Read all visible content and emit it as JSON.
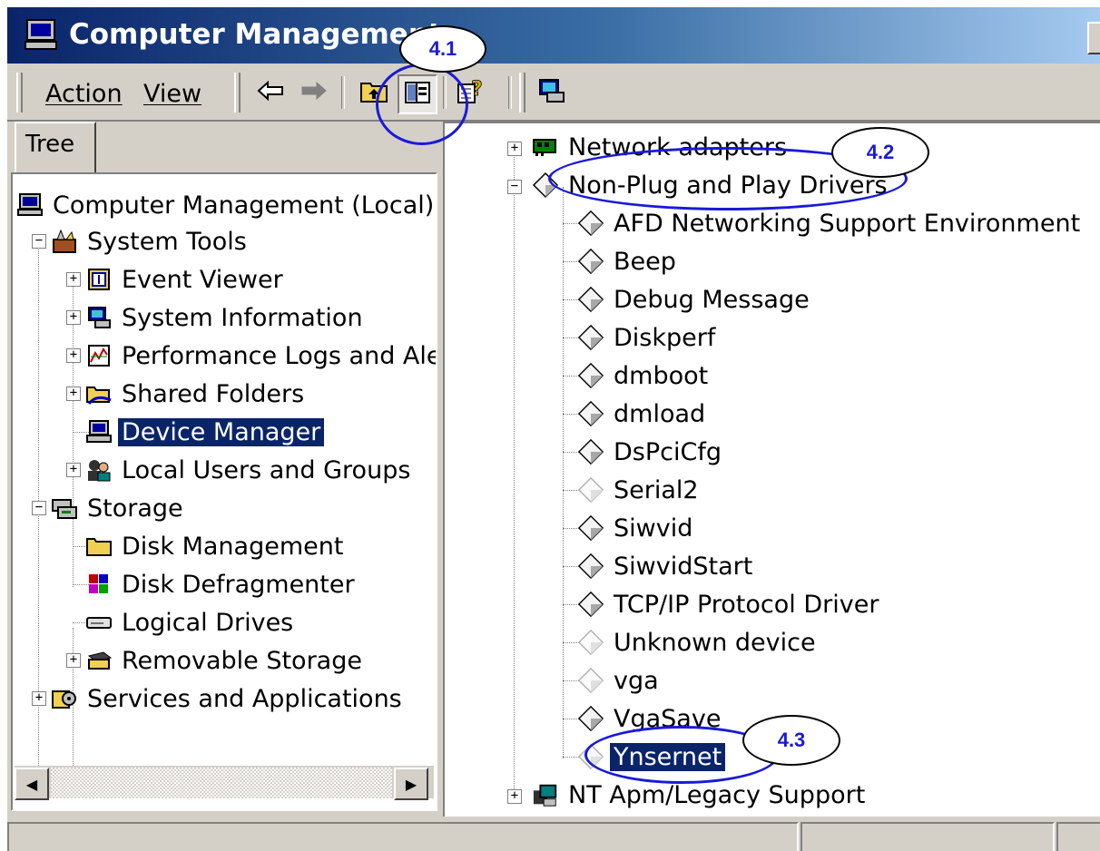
{
  "window": {
    "title": "Computer Management",
    "icon": "computer-management-icon"
  },
  "menu": {
    "action": "Action",
    "view": "View"
  },
  "toolbar": {
    "buttons": [
      "back-arrow-icon",
      "forward-arrow-icon",
      "up-level-icon",
      "show-hide-tree-icon",
      "help-icon",
      "properties-icon"
    ]
  },
  "tree_pane": {
    "tab_label": "Tree",
    "items": [
      {
        "label": "Computer Management (Local)",
        "icon": "computer-icon"
      },
      {
        "label": "System Tools",
        "icon": "tools-icon"
      },
      {
        "label": "Event Viewer",
        "icon": "event-viewer-icon"
      },
      {
        "label": "System Information",
        "icon": "system-info-icon"
      },
      {
        "label": "Performance Logs and Ale",
        "icon": "performance-icon"
      },
      {
        "label": "Shared Folders",
        "icon": "shared-folder-icon"
      },
      {
        "label": "Device Manager",
        "icon": "device-manager-icon",
        "selected": true
      },
      {
        "label": "Local Users and Groups",
        "icon": "users-icon"
      },
      {
        "label": "Storage",
        "icon": "storage-icon"
      },
      {
        "label": "Disk Management",
        "icon": "folder-icon"
      },
      {
        "label": "Disk Defragmenter",
        "icon": "defrag-icon"
      },
      {
        "label": "Logical Drives",
        "icon": "drive-icon"
      },
      {
        "label": "Removable Storage",
        "icon": "removable-storage-icon"
      },
      {
        "label": "Services and Applications",
        "icon": "services-icon"
      }
    ]
  },
  "device_pane": {
    "items": [
      {
        "label": "Network adapters",
        "icon": "network-adapter-icon"
      },
      {
        "label": "Non-Plug and Play Drivers",
        "icon": "driver-diamond-icon"
      },
      {
        "label": "AFD Networking Support Environment",
        "icon": "driver-diamond-icon"
      },
      {
        "label": "Beep",
        "icon": "driver-diamond-icon"
      },
      {
        "label": "Debug Message",
        "icon": "driver-diamond-icon"
      },
      {
        "label": "Diskperf",
        "icon": "driver-diamond-icon"
      },
      {
        "label": "dmboot",
        "icon": "driver-diamond-icon"
      },
      {
        "label": "dmload",
        "icon": "driver-diamond-icon"
      },
      {
        "label": "DsPciCfg",
        "icon": "driver-diamond-icon"
      },
      {
        "label": "Serial2",
        "icon": "driver-diamond-faded-icon"
      },
      {
        "label": "Siwvid",
        "icon": "driver-diamond-icon"
      },
      {
        "label": "SiwvidStart",
        "icon": "driver-diamond-icon"
      },
      {
        "label": "TCP/IP Protocol Driver",
        "icon": "driver-diamond-icon"
      },
      {
        "label": "Unknown device",
        "icon": "driver-diamond-faded-icon"
      },
      {
        "label": "vga",
        "icon": "driver-diamond-faded-icon"
      },
      {
        "label": "VgaSave",
        "icon": "driver-diamond-icon"
      },
      {
        "label": "Ynsernet",
        "icon": "driver-diamond-faded-icon",
        "selected": true
      },
      {
        "label": "NT Apm/Legacy Support",
        "icon": "legacy-support-icon"
      }
    ]
  },
  "callouts": {
    "c1": "4.1",
    "c2": "4.2",
    "c3": "4.3"
  },
  "colors": {
    "annotation_blue": "#1a1ad8",
    "selection": "#0a246a",
    "face": "#d4d0c8"
  }
}
